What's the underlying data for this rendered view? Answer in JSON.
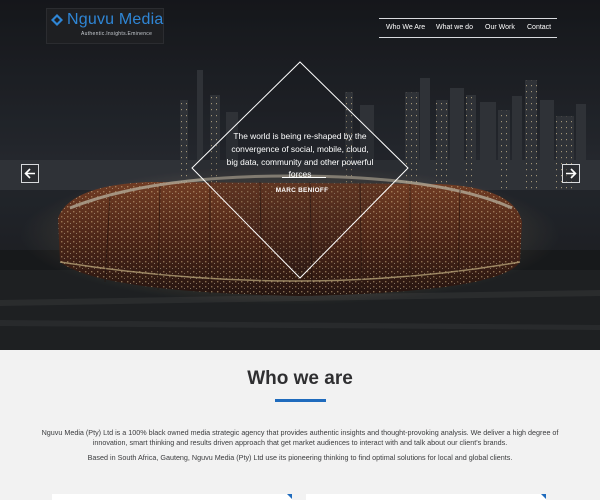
{
  "header": {
    "brand": "Nguvu Media",
    "tagline": "Authentic.Insights.Eminence",
    "nav": [
      "Who We Are",
      "What we do",
      "Our Work",
      "Contact"
    ]
  },
  "hero": {
    "quote": "The world is being re-shaped by the convergence of social, mobile, cloud, big data, community and other powerful forces",
    "author": "MARC BENIOFF",
    "prev_icon": "arrow-left-icon",
    "next_icon": "arrow-right-icon"
  },
  "about": {
    "title": "Who we are",
    "paragraph_1": "Nguvu Media (Pty) Ltd is a 100% black owned media strategic agency that provides authentic insights and thought-provoking analysis. We deliver a high degree of innovation, smart thinking and results driven approach that get market audiences to interact with and talk about our client's brands.",
    "paragraph_2": "Based in South Africa, Gauteng, Nguvu Media (Pty) Ltd use its pioneering thinking to find optimal solutions for local and global clients."
  },
  "colors": {
    "accent": "#1f6bbd",
    "brand": "#2f86d6",
    "page_background": "#f2f2f2"
  }
}
